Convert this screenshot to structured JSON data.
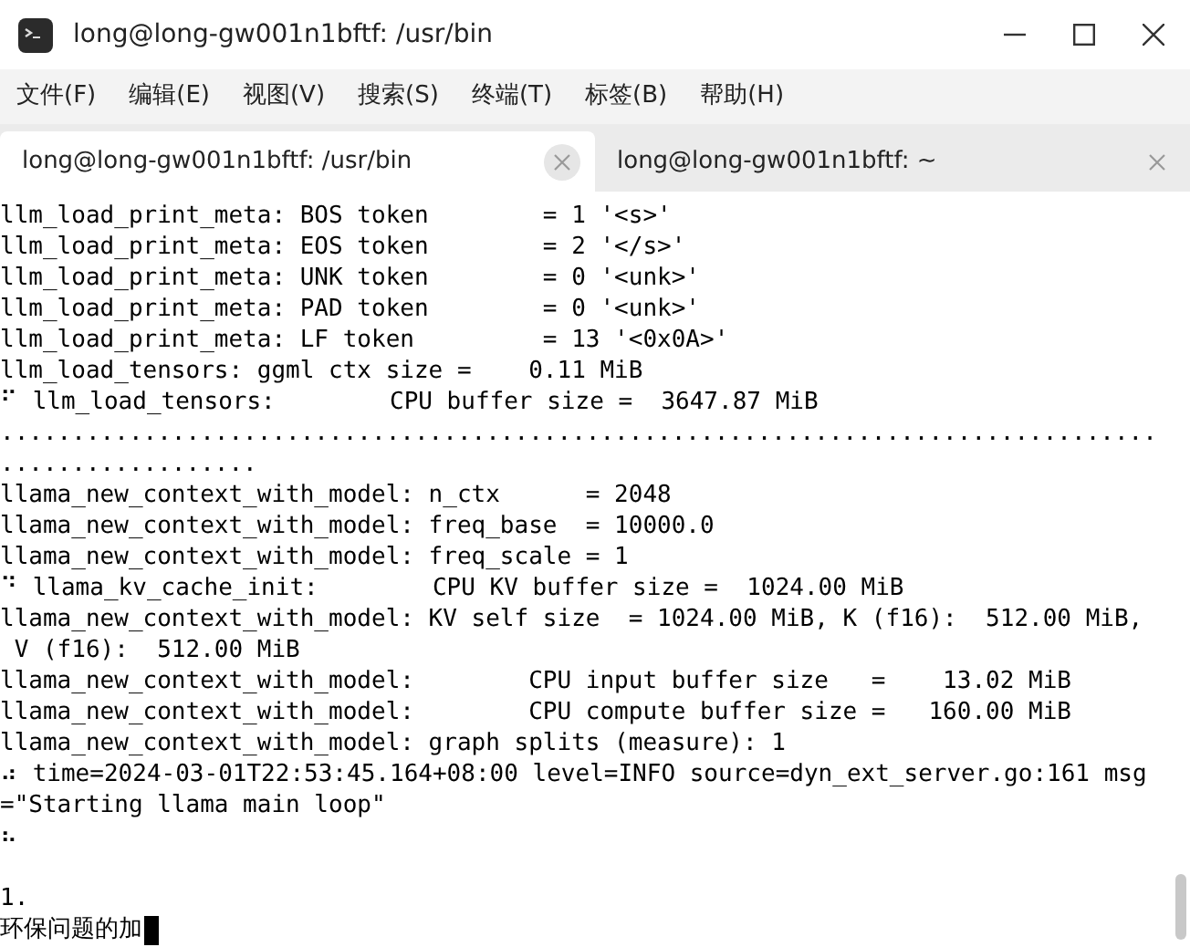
{
  "window": {
    "title": "long@long-gw001n1bftf: /usr/bin"
  },
  "menu": [
    "文件(F)",
    "编辑(E)",
    "视图(V)",
    "搜索(S)",
    "终端(T)",
    "标签(B)",
    "帮助(H)"
  ],
  "tabs": [
    {
      "label": "long@long-gw001n1bftf: /usr/bin",
      "selected": true
    },
    {
      "label": "long@long-gw001n1bftf: ~",
      "selected": false
    }
  ],
  "terminal": {
    "lines": [
      "llm_load_print_meta: BOS token        = 1 '<s>'",
      "llm_load_print_meta: EOS token        = 2 '</s>'",
      "llm_load_print_meta: UNK token        = 0 '<unk>'",
      "llm_load_print_meta: PAD token        = 0 '<unk>'",
      "llm_load_print_meta: LF token         = 13 '<0x0A>'",
      "llm_load_tensors: ggml ctx size =    0.11 MiB",
      "⠋ llm_load_tensors:        CPU buffer size =  3647.87 MiB",
      ".................................................................................",
      "..................",
      "llama_new_context_with_model: n_ctx      = 2048",
      "llama_new_context_with_model: freq_base  = 10000.0",
      "llama_new_context_with_model: freq_scale = 1",
      "⠙ llama_kv_cache_init:        CPU KV buffer size =  1024.00 MiB",
      "llama_new_context_with_model: KV self size  = 1024.00 MiB, K (f16):  512.00 MiB,",
      " V (f16):  512.00 MiB",
      "llama_new_context_with_model:        CPU input buffer size   =    13.02 MiB",
      "llama_new_context_with_model:        CPU compute buffer size =   160.00 MiB",
      "llama_new_context_with_model: graph splits (measure): 1",
      "⠴ time=2024-03-01T22:53:45.164+08:00 level=INFO source=dyn_ext_server.go:161 msg",
      "=\"Starting llama main loop\"",
      "⠦"
    ],
    "input_lines": [
      "1.",
      "环保问题的加"
    ],
    "cursor": true
  }
}
